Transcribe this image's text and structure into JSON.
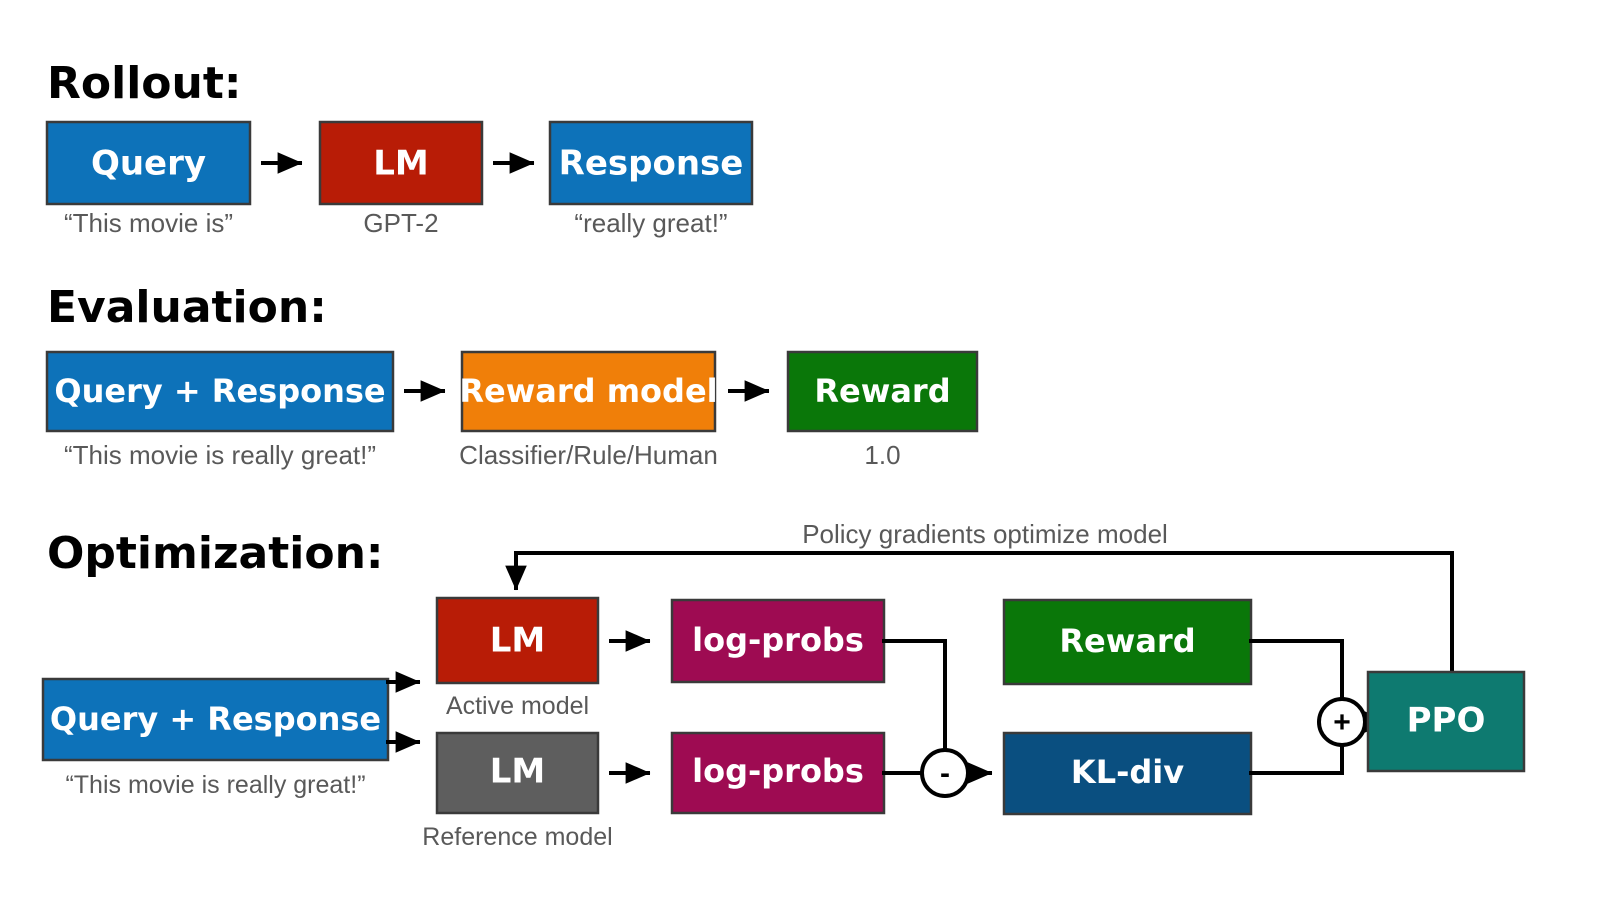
{
  "figure": {
    "title": "RLHF / PPO training loop diagram",
    "sections": [
      {
        "id": "rollout",
        "label": "Rollout:"
      },
      {
        "id": "evaluation",
        "label": "Evaluation:"
      },
      {
        "id": "optimization",
        "label": "Optimization:"
      }
    ]
  },
  "colors": {
    "blue": "#0d72b9",
    "red": "#b81c06",
    "orange": "#f07f09",
    "green": "#0a7709",
    "magenta": "#9e0b52",
    "darkblue": "#0a4f80",
    "teal": "#0e7a70",
    "gray": "#5e5e5e",
    "caption_gray": "#595959",
    "stroke": "#3a3a3a",
    "wire": "#000000",
    "background": "#ffffff"
  },
  "rollout": {
    "nodes": [
      {
        "id": "query",
        "label": "Query",
        "caption": "“This movie is”",
        "color": "blue"
      },
      {
        "id": "lm",
        "label": "LM",
        "caption": "GPT-2",
        "color": "red"
      },
      {
        "id": "response",
        "label": "Response",
        "caption": "“really great!”",
        "color": "blue"
      }
    ]
  },
  "evaluation": {
    "nodes": [
      {
        "id": "query-response",
        "label": "Query + Response",
        "caption": "“This movie is really great!”",
        "color": "blue"
      },
      {
        "id": "reward-model",
        "label": "Reward model",
        "caption": "Classifier/Rule/Human",
        "color": "orange"
      },
      {
        "id": "reward",
        "label": "Reward",
        "caption": "1.0",
        "color": "green"
      }
    ]
  },
  "optimization": {
    "feedback_label": "Policy gradients optimize model",
    "nodes": [
      {
        "id": "query-response",
        "label": "Query + Response",
        "caption": "“This movie is really great!”",
        "color": "blue"
      },
      {
        "id": "lm-active",
        "label": "LM",
        "caption": "Active model",
        "color": "red"
      },
      {
        "id": "lm-reference",
        "label": "LM",
        "caption": "Reference model",
        "color": "gray"
      },
      {
        "id": "log-probs-active",
        "label": "log-probs",
        "caption": "",
        "color": "magenta"
      },
      {
        "id": "log-probs-reference",
        "label": "log-probs",
        "caption": "",
        "color": "magenta"
      },
      {
        "id": "reward",
        "label": "Reward",
        "caption": "",
        "color": "green"
      },
      {
        "id": "kl-div",
        "label": "KL-div",
        "caption": "",
        "color": "darkblue"
      },
      {
        "id": "ppo",
        "label": "PPO",
        "caption": "",
        "color": "teal"
      }
    ],
    "operators": [
      {
        "id": "subtract",
        "symbol": "-"
      },
      {
        "id": "add",
        "symbol": "+"
      }
    ]
  }
}
